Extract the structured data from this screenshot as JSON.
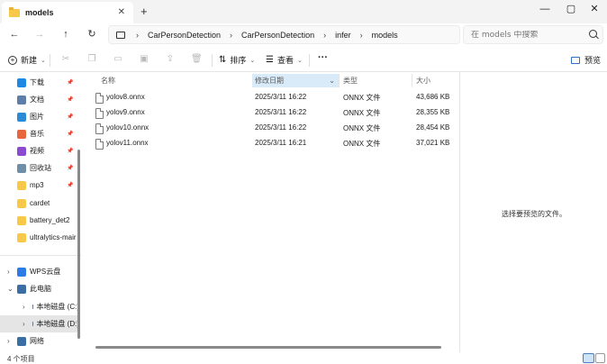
{
  "window": {
    "tab_title": "models",
    "tab_close": "✕",
    "tab_add": "+",
    "minimize": "—",
    "maximize": "▢",
    "close": "✕"
  },
  "nav": {
    "back": "←",
    "forward": "→",
    "up": "↑",
    "refresh": "↻",
    "breadcrumb": [
      "CarPersonDetection",
      "CarPersonDetection",
      "infer",
      "models"
    ],
    "search_placeholder": "在 models 中搜索"
  },
  "toolbar": {
    "new_label": "新建",
    "sort_label": "排序",
    "view_label": "查看",
    "more_label": "···",
    "preview_label": "预览"
  },
  "sidebar": {
    "quick_access": [
      {
        "label": "下载",
        "icon": "download-icon",
        "color": "#1e88e5",
        "pinned": true
      },
      {
        "label": "文档",
        "icon": "document-icon",
        "color": "#5c7ea8",
        "pinned": true
      },
      {
        "label": "图片",
        "icon": "picture-icon",
        "color": "#2b8ad6",
        "pinned": true
      },
      {
        "label": "音乐",
        "icon": "music-icon",
        "color": "#e8663c",
        "pinned": true
      },
      {
        "label": "视频",
        "icon": "video-icon",
        "color": "#8a4bd1",
        "pinned": true
      },
      {
        "label": "回收站",
        "icon": "recycle-bin-icon",
        "color": "#6f8fa8",
        "pinned": true
      },
      {
        "label": "mp3",
        "icon": "folder-icon",
        "color": "#f8c948",
        "pinned": true
      },
      {
        "label": "cardet",
        "icon": "folder-icon",
        "color": "#f8c948",
        "pinned": false
      },
      {
        "label": "battery_det2",
        "icon": "folder-icon",
        "color": "#f8c948",
        "pinned": false
      },
      {
        "label": "ultralytics-mair",
        "icon": "folder-icon",
        "color": "#f8c948",
        "pinned": false
      }
    ],
    "tree": [
      {
        "label": "WPS云盘",
        "icon": "cloud-icon",
        "color": "#2d7be5",
        "expander": "›"
      },
      {
        "label": "此电脑",
        "icon": "computer-icon",
        "color": "#3a6ea5",
        "expander": "⌄"
      },
      {
        "label": "本地磁盘 (C:)",
        "icon": "drive-icon",
        "color": "#6a7a8a",
        "expander": "›"
      },
      {
        "label": "本地磁盘 (D:)",
        "icon": "drive-icon",
        "color": "#6a7a8a",
        "expander": "›",
        "selected": true
      },
      {
        "label": "网络",
        "icon": "network-icon",
        "color": "#3a6ea5",
        "expander": "›"
      }
    ]
  },
  "columns": {
    "name": "名称",
    "date": "修改日期",
    "type": "类型",
    "size": "大小"
  },
  "files": [
    {
      "name": "yolov8.onnx",
      "date": "2025/3/11 16:22",
      "type": "ONNX 文件",
      "size": "43,686 KB"
    },
    {
      "name": "yolov9.onnx",
      "date": "2025/3/11 16:22",
      "type": "ONNX 文件",
      "size": "28,355 KB"
    },
    {
      "name": "yolov10.onnx",
      "date": "2025/3/11 16:22",
      "type": "ONNX 文件",
      "size": "28,454 KB"
    },
    {
      "name": "yolov11.onnx",
      "date": "2025/3/11 16:21",
      "type": "ONNX 文件",
      "size": "37,021 KB"
    }
  ],
  "preview_pane": {
    "message": "选择要预览的文件。"
  },
  "status": {
    "item_count": "4 个项目"
  }
}
